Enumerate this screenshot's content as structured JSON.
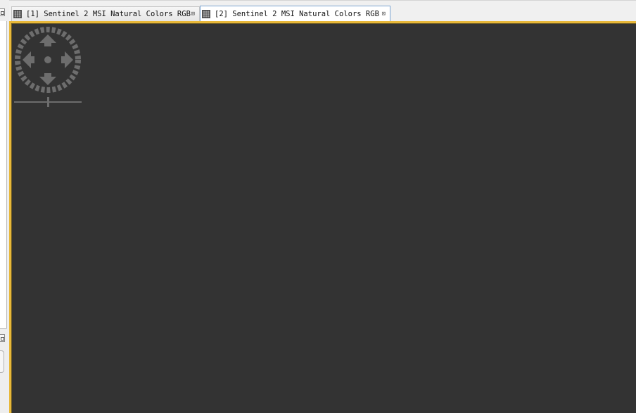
{
  "tabs": [
    {
      "label": "[1] Sentinel 2 MSI Natural Colors RGB",
      "close_glyph": "⊠",
      "active": false
    },
    {
      "label": "[2] Sentinel 2 MSI Natural Colors RGB",
      "close_glyph": "⊠",
      "active": true
    }
  ],
  "image_view": {
    "background": "#333333",
    "accent_border": "#e8b83a",
    "navigation_control": {
      "arrows": [
        "up",
        "down",
        "left",
        "right"
      ],
      "icon": "pan-navigator-icon"
    },
    "zoom_slider": {
      "icon": "zoom-slider",
      "level": 0.5
    }
  }
}
